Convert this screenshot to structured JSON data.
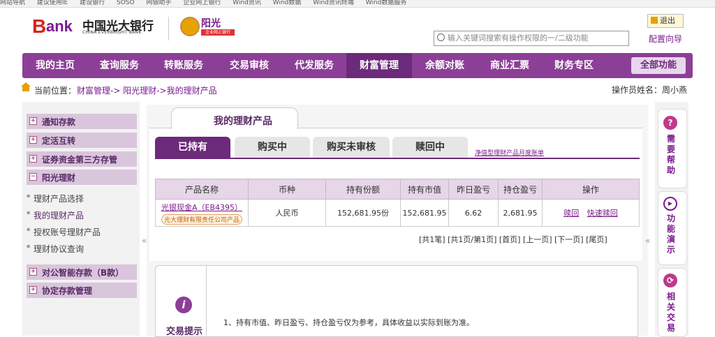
{
  "bookmarks": [
    "网站导航",
    "建议使用IE",
    "建设银行",
    "SOSO",
    "网银助手",
    "企业网上银行",
    "Wind资讯",
    "Wind数据",
    "Wind资讯终端",
    "Wind数据服务"
  ],
  "brand": {
    "logo_b": "B",
    "logo_ank": "ank",
    "name_cn": "中国光大银行",
    "name_en": "CHINA EVERBRIGHT BANK",
    "sub_logo": "阳光",
    "sub_logo_caption": "企业网上银行"
  },
  "header": {
    "logout": "退出",
    "search_placeholder": "输入关键词搜索有操作权限的一/二级功能",
    "guide": "配置向导"
  },
  "nav": {
    "items": [
      "我的主页",
      "查询服务",
      "转账服务",
      "交易审核",
      "代发服务",
      "财富管理",
      "余额对账",
      "商业汇票",
      "财务专区"
    ],
    "active": "财富管理",
    "all": "全部功能"
  },
  "breadcrumb": {
    "label": "当前位置：",
    "path": "财富管理-> 阳光理财->我的理财产品",
    "operator": "操作员姓名：周小燕"
  },
  "sidebar": {
    "groups": [
      {
        "label": "通知存款",
        "sign": "+"
      },
      {
        "label": "定活互转",
        "sign": "+"
      },
      {
        "label": "证券资金第三方存管",
        "sign": "+"
      },
      {
        "label": "阳光理财",
        "sign": "−"
      },
      {
        "label": "对公智能存款（B款）",
        "sign": "+"
      },
      {
        "label": "协定存款管理",
        "sign": "+"
      }
    ],
    "subitems": [
      "理财产品选择",
      "我的理财产品",
      "授权账号理财产品",
      "理财协议查询"
    ],
    "collapse": "«"
  },
  "main": {
    "title": "我的理财产品",
    "tabs": [
      "已持有",
      "购买中",
      "购买未审核",
      "赎回中"
    ],
    "net_link": "净值型理财产品月度账单",
    "table": {
      "headers": [
        "产品名称",
        "币种",
        "持有份额",
        "持有市值",
        "昨日盈亏",
        "持仓盈亏",
        "操作"
      ],
      "rows": [
        {
          "name": "光银现金A（EB4395）",
          "tag": "光大理财有限责任公司产品",
          "currency": "人民币",
          "shares": "152,681.95份",
          "market_value": "152,681.95",
          "daily_pl": "6.62",
          "position_pl": "2,681.95",
          "op1": "赎回",
          "op2": "快速赎回"
        }
      ]
    },
    "pager": "[共1笔] [共1页/第1页] [首页] [上一页] [下一页] [尾页]",
    "collapse_right": "«"
  },
  "tips": {
    "icon": "i",
    "title": "交易提示",
    "text": "1、持有市值、昨日盈亏、持仓盈亏仅为参考，具体收益以实际到账为准。"
  },
  "rightbar": [
    {
      "icon": "?",
      "label": "需要帮助",
      "color": "#c0398a"
    },
    {
      "icon": "▶",
      "label": "功能演示",
      "color": "#7a1a8c"
    },
    {
      "icon": "⟳",
      "label": "相关交易",
      "color": "#c0398a"
    }
  ]
}
